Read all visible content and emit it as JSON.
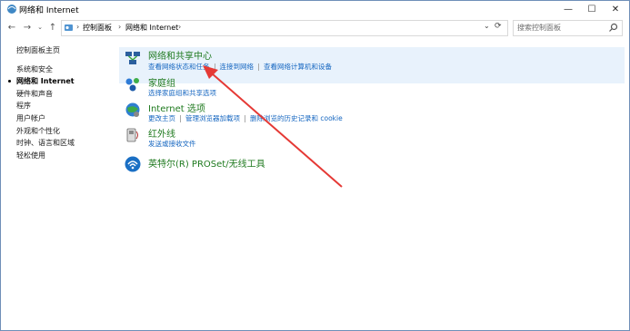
{
  "window": {
    "title": "网络和 Internet",
    "controls": {
      "minimize": "—",
      "maximize": "☐",
      "close": "✕"
    }
  },
  "nav": {
    "back": "←",
    "forward": "→",
    "up": "↑",
    "dropdown": "⌄",
    "refresh": "⟳"
  },
  "address": {
    "breadcrumbs": [
      "控制面板",
      "网络和 Internet"
    ],
    "separator": "›"
  },
  "search": {
    "placeholder": "搜索控制面板"
  },
  "sidebar": {
    "items": [
      {
        "label": "控制面板主页",
        "current": false
      },
      {
        "label": "系统和安全",
        "current": false
      },
      {
        "label": "网络和 Internet",
        "current": true
      },
      {
        "label": "硬件和声音",
        "current": false
      },
      {
        "label": "程序",
        "current": false
      },
      {
        "label": "用户帐户",
        "current": false
      },
      {
        "label": "外观和个性化",
        "current": false
      },
      {
        "label": "时钟、语言和区域",
        "current": false
      },
      {
        "label": "轻松使用",
        "current": false
      }
    ]
  },
  "categories": [
    {
      "icon": "network-center-icon",
      "heading": "网络和共享中心",
      "links": [
        "查看网络状态和任务",
        "连接到网络",
        "查看网络计算机和设备"
      ]
    },
    {
      "icon": "homegroup-icon",
      "heading": "家庭组",
      "links": [
        "选择家庭组和共享选项"
      ]
    },
    {
      "icon": "internet-options-icon",
      "heading": "Internet 选项",
      "links": [
        "更改主页",
        "管理浏览器加载项",
        "删除浏览的历史记录和 cookie"
      ]
    },
    {
      "icon": "infrared-icon",
      "heading": "红外线",
      "links": [
        "发送或接收文件"
      ]
    },
    {
      "icon": "wireless-icon",
      "heading": "英特尔(R) PROSet/无线工具",
      "links": []
    }
  ],
  "colors": {
    "accent_link": "#1566c0",
    "heading": "#1f7a1f",
    "highlight": "#e8f2fc",
    "annotation_arrow": "#e53935"
  }
}
